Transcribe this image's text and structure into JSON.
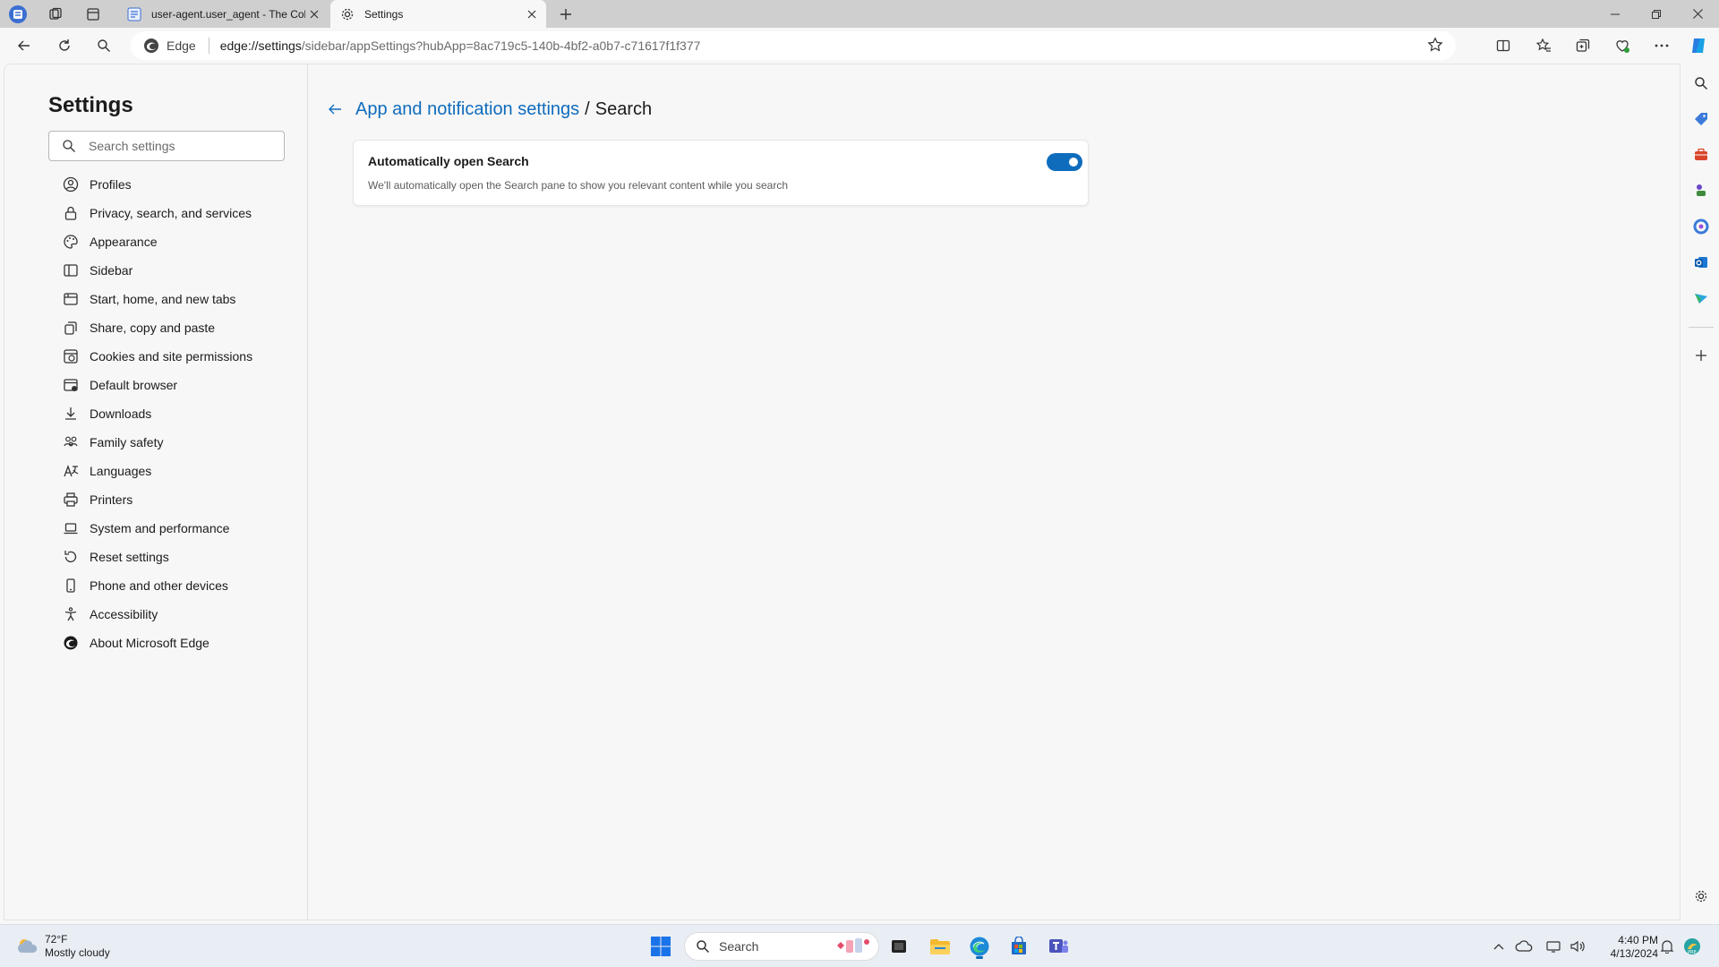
{
  "tabs": [
    {
      "title": "user-agent.user_agent - The Coll",
      "active": false
    },
    {
      "title": "Settings",
      "active": true
    }
  ],
  "address": {
    "site_label": "Edge",
    "url_bold": "edge://settings",
    "url_rest": "/sidebar/appSettings?hubApp=8ac719c5-140b-4bf2-a0b7-c71617f1f377"
  },
  "settings_nav": {
    "title": "Settings",
    "search_placeholder": "Search settings",
    "items": [
      {
        "label": "Profiles",
        "icon": "profile-icon"
      },
      {
        "label": "Privacy, search, and services",
        "icon": "lock-icon"
      },
      {
        "label": "Appearance",
        "icon": "palette-icon"
      },
      {
        "label": "Sidebar",
        "icon": "sidebar-icon"
      },
      {
        "label": "Start, home, and new tabs",
        "icon": "home-tabs-icon"
      },
      {
        "label": "Share, copy and paste",
        "icon": "share-icon"
      },
      {
        "label": "Cookies and site permissions",
        "icon": "cookies-icon"
      },
      {
        "label": "Default browser",
        "icon": "browser-icon"
      },
      {
        "label": "Downloads",
        "icon": "download-icon"
      },
      {
        "label": "Family safety",
        "icon": "family-icon"
      },
      {
        "label": "Languages",
        "icon": "language-icon"
      },
      {
        "label": "Printers",
        "icon": "printer-icon"
      },
      {
        "label": "System and performance",
        "icon": "laptop-icon"
      },
      {
        "label": "Reset settings",
        "icon": "reset-icon"
      },
      {
        "label": "Phone and other devices",
        "icon": "phone-icon"
      },
      {
        "label": "Accessibility",
        "icon": "accessibility-icon"
      },
      {
        "label": "About Microsoft Edge",
        "icon": "edge-logo-icon"
      }
    ]
  },
  "page": {
    "breadcrumb_parent": "App and notification settings",
    "breadcrumb_sep": "/",
    "breadcrumb_current": "Search",
    "setting": {
      "title": "Automatically open Search",
      "description": "We'll automatically open the Search pane to show you relevant content while you search",
      "toggle_on": true
    }
  },
  "taskbar": {
    "weather_temp": "72°F",
    "weather_desc": "Mostly cloudy",
    "search_label": "Search",
    "time": "4:40 PM",
    "date": "4/13/2024"
  },
  "colors": {
    "accent": "#0f6cbd",
    "link": "#0f6cbd"
  }
}
